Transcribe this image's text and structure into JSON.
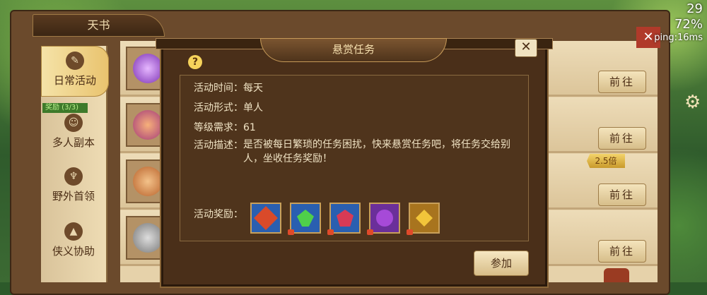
{
  "book": {
    "title": "天书",
    "sidebar": [
      {
        "label": "日常活动",
        "icon": "scroll-icon",
        "active": true
      },
      {
        "label": "多人副本",
        "icon": "mask-icon",
        "active": false
      },
      {
        "label": "野外首领",
        "icon": "demon-icon",
        "active": false
      },
      {
        "label": "侠义协助",
        "icon": "hat-icon",
        "active": false
      }
    ],
    "reward_tag": "奖励 (3/3)",
    "go_button": "前往",
    "multiplier_badge": "2.5倍"
  },
  "modal": {
    "title": "悬赏任务",
    "close_icon": "close-icon",
    "help_icon": "help-icon",
    "help_glyph": "?",
    "fields": {
      "time": {
        "label": "活动时间：",
        "value": "每天"
      },
      "form": {
        "label": "活动形式：",
        "value": "单人"
      },
      "level": {
        "label": "等级需求：",
        "value": "61"
      },
      "desc": {
        "label": "活动描述：",
        "value": "是否被每日繁琐的任务困扰，快来悬赏任务吧，将任务交给别人，坐收任务奖励！"
      }
    },
    "reward_label": "活动奖励：",
    "rewards": [
      {
        "icon": "fortune-card-icon",
        "color": "#d94a2a"
      },
      {
        "icon": "green-gem-icon",
        "color": "#4fcf4a"
      },
      {
        "icon": "red-gem-icon",
        "color": "#d83a55"
      },
      {
        "icon": "purple-orb-icon",
        "color": "#a64ad8"
      },
      {
        "icon": "gold-gem-icon",
        "color": "#f2c53a"
      }
    ],
    "join_button": "参加"
  },
  "hud": {
    "level": "29",
    "battery": "72%",
    "ping": "ping:16ms"
  }
}
